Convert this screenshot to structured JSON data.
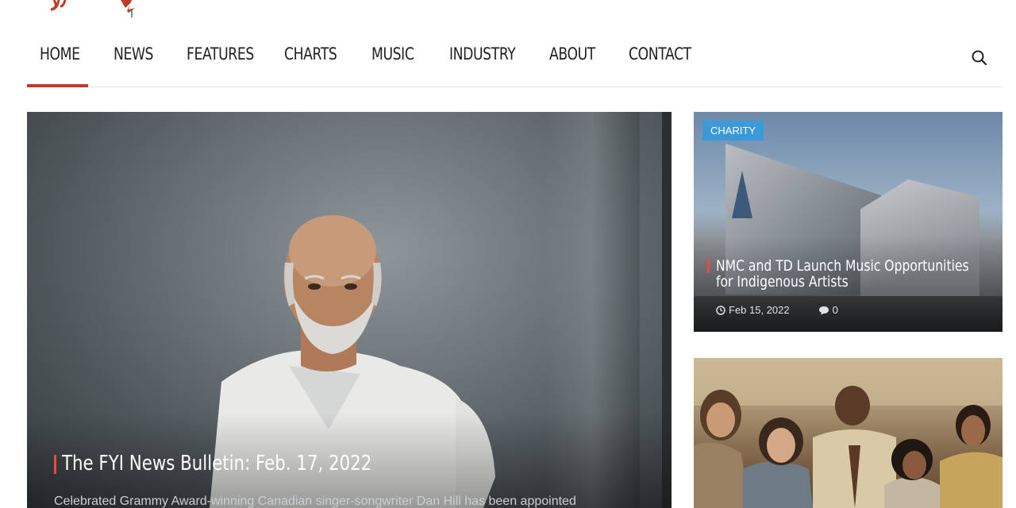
{
  "nav": {
    "items": [
      {
        "label": "HOME",
        "active": true
      },
      {
        "label": "NEWS"
      },
      {
        "label": "FEATURES"
      },
      {
        "label": "CHARTS"
      },
      {
        "label": "MUSIC"
      },
      {
        "label": "INDUSTRY"
      },
      {
        "label": "ABOUT"
      },
      {
        "label": "CONTACT"
      }
    ],
    "search_icon": "search-icon",
    "accent": "#c0392b"
  },
  "hero": {
    "title": "The FYI News Bulletin: Feb. 17, 2022",
    "excerpt": "Celebrated Grammy Award-winning Canadian singer-songwriter Dan Hill has been appointed"
  },
  "cards": [
    {
      "category": "CHARITY",
      "title": "NMC and TD Launch Music Opportunities for Indigenous Artists",
      "date": "Feb 15, 2022",
      "comments": "0"
    }
  ],
  "colors": {
    "badge": "#3a9ad9",
    "title_accent": "#e74c3c"
  }
}
